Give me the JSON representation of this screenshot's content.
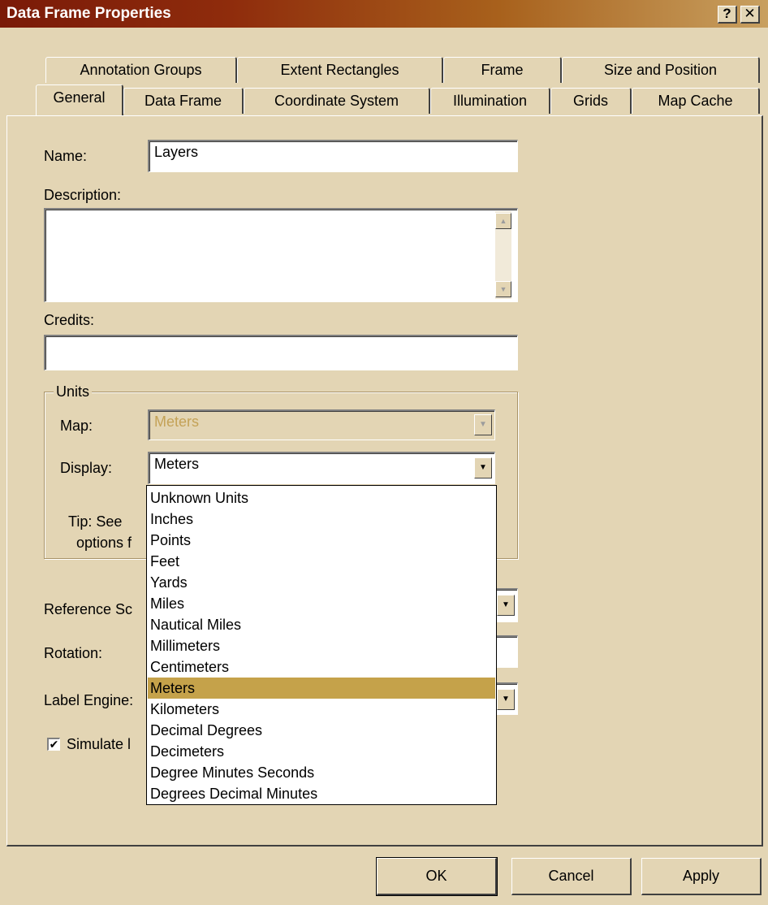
{
  "window": {
    "title": "Data Frame Properties",
    "help_label": "?",
    "close_label": "✕"
  },
  "tabs_back": [
    "Annotation Groups",
    "Extent Rectangles",
    "Frame",
    "Size and Position"
  ],
  "tabs_front": [
    "General",
    "Data Frame",
    "Coordinate System",
    "Illumination",
    "Grids",
    "Map Cache"
  ],
  "selected_tab": "General",
  "general": {
    "name_label": "Name:",
    "name_value": "Layers",
    "description_label": "Description:",
    "description_value": "",
    "credits_label": "Credits:",
    "credits_value": "",
    "units_group_label": "Units",
    "map_label": "Map:",
    "map_value": "Meters",
    "display_label": "Display:",
    "display_value": "Meters",
    "tip_line1": "Tip: See",
    "tip_line2": "options f",
    "reference_scale_label": "Reference Sc",
    "rotation_label": "Rotation:",
    "label_engine_label": "Label Engine:",
    "simulate_label": "Simulate l",
    "simulate_checked": true
  },
  "display_options": [
    "Unknown Units",
    "Inches",
    "Points",
    "Feet",
    "Yards",
    "Miles",
    "Nautical Miles",
    "Millimeters",
    "Centimeters",
    "Meters",
    "Kilometers",
    "Decimal Degrees",
    "Decimeters",
    "Degree Minutes Seconds",
    "Degrees Decimal Minutes"
  ],
  "display_selected_index": 9,
  "buttons": {
    "ok": "OK",
    "cancel": "Cancel",
    "apply": "Apply"
  },
  "colors": {
    "dialog_bg": "#e3d5b4",
    "highlight": "#c5a24a",
    "title_start": "#7a1a08"
  }
}
